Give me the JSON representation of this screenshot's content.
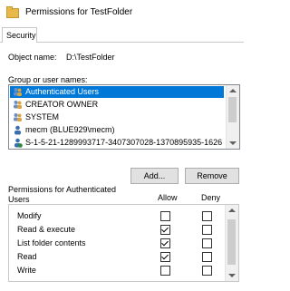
{
  "window": {
    "title": "Permissions for TestFolder",
    "icon": "folder-icon"
  },
  "tabs": [
    {
      "label": "Security",
      "active": true
    }
  ],
  "object": {
    "label": "Object name:",
    "value": "D:\\TestFolder"
  },
  "group": {
    "label": "Group or user names:",
    "items": [
      {
        "name": "Authenticated Users",
        "icon": "users-group-icon",
        "selected": true
      },
      {
        "name": "CREATOR OWNER",
        "icon": "users-group-icon",
        "selected": false
      },
      {
        "name": "SYSTEM",
        "icon": "users-group-icon",
        "selected": false
      },
      {
        "name": "mecm (BLUE929\\mecm)",
        "icon": "user-icon",
        "selected": false
      },
      {
        "name": "S-1-5-21-1289993717-3407307028-1370895935-1626",
        "icon": "unknown-user-icon",
        "selected": false
      }
    ]
  },
  "buttons": {
    "add": "Add...",
    "remove": "Remove"
  },
  "permissions": {
    "header": "Permissions for Authenticated Users",
    "header_line1": "Permissions for Authenticated",
    "header_line2": "Users",
    "allow_label": "Allow",
    "deny_label": "Deny",
    "rows": [
      {
        "name": "Modify",
        "allow": false,
        "deny": false
      },
      {
        "name": "Read & execute",
        "allow": true,
        "deny": false
      },
      {
        "name": "List folder contents",
        "allow": true,
        "deny": false
      },
      {
        "name": "Read",
        "allow": true,
        "deny": false
      },
      {
        "name": "Write",
        "allow": false,
        "deny": false
      }
    ]
  },
  "colors": {
    "selection": "#0078d7",
    "button_face": "#e1e1e1",
    "border": "#828790"
  }
}
